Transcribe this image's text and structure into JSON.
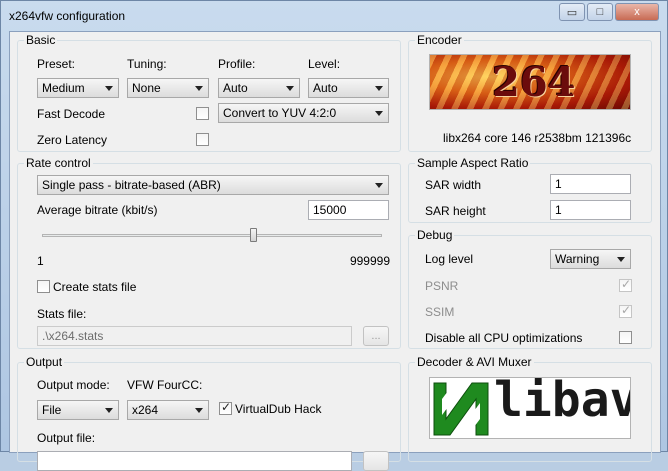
{
  "window": {
    "title": "x264vfw configuration",
    "minimize_glyph": "▭",
    "maximize_glyph": "□",
    "close_glyph": "x"
  },
  "basic": {
    "group_label": "Basic",
    "preset_label": "Preset:",
    "preset_value": "Medium",
    "tuning_label": "Tuning:",
    "tuning_value": "None",
    "profile_label": "Profile:",
    "profile_value": "Auto",
    "level_label": "Level:",
    "level_value": "Auto",
    "fast_decode_label": "Fast Decode",
    "fast_decode_checked": false,
    "colorspace_value": "Convert to YUV 4:2:0",
    "zero_latency_label": "Zero Latency",
    "zero_latency_checked": false
  },
  "encoder": {
    "group_label": "Encoder",
    "logo_text": "264",
    "version_text": "libx264 core 146 r2538bm 121396c"
  },
  "rate_control": {
    "group_label": "Rate control",
    "mode_value": "Single pass - bitrate-based (ABR)",
    "bitrate_label": "Average bitrate (kbit/s)",
    "bitrate_value": "15000",
    "slider_min": "1",
    "slider_max": "999999",
    "slider_fraction": 0.62,
    "create_stats_label": "Create stats file",
    "create_stats_checked": false,
    "stats_file_label": "Stats file:",
    "stats_file_value": ".\\x264.stats",
    "browse_label": "..."
  },
  "sar": {
    "group_label": "Sample Aspect Ratio",
    "width_label": "SAR width",
    "width_value": "1",
    "height_label": "SAR height",
    "height_value": "1"
  },
  "debug": {
    "group_label": "Debug",
    "log_level_label": "Log level",
    "log_level_value": "Warning",
    "psnr_label": "PSNR",
    "psnr_checked": true,
    "ssim_label": "SSIM",
    "ssim_checked": true,
    "disable_cpu_label": "Disable all CPU optimizations",
    "disable_cpu_checked": false
  },
  "output": {
    "group_label": "Output",
    "mode_label": "Output mode:",
    "mode_value": "File",
    "fourcc_label": "VFW FourCC:",
    "fourcc_value": "x264",
    "vdub_hack_label": "VirtualDub Hack",
    "vdub_hack_checked": true,
    "file_label": "Output file:"
  },
  "decoder": {
    "group_label": "Decoder & AVI Muxer",
    "logo_text": "libav"
  }
}
